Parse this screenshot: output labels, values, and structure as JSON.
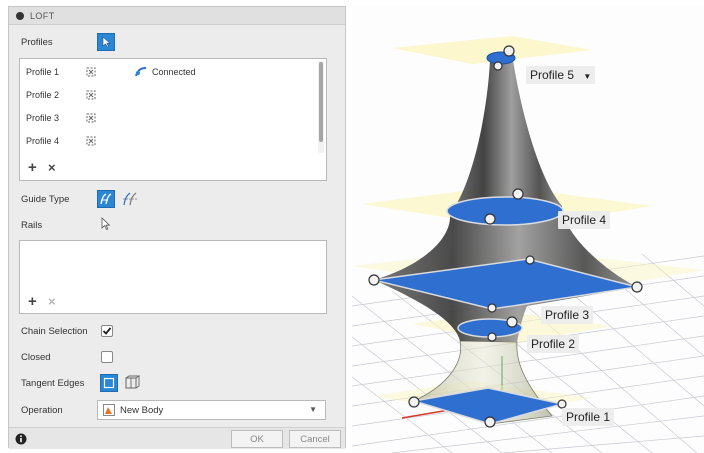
{
  "dialog": {
    "title": "LOFT",
    "profiles_label": "Profiles",
    "profile_list": [
      {
        "label": "Profile 1",
        "status": "Connected"
      },
      {
        "label": "Profile 2",
        "status": ""
      },
      {
        "label": "Profile 3",
        "status": ""
      },
      {
        "label": "Profile 4",
        "status": ""
      }
    ],
    "guide_type_label": "Guide Type",
    "rails_label": "Rails",
    "chain_selection_label": "Chain Selection",
    "chain_selection_checked": true,
    "closed_label": "Closed",
    "closed_checked": false,
    "tangent_edges_label": "Tangent Edges",
    "operation_label": "Operation",
    "operation_value": "New Body",
    "ok_label": "OK",
    "cancel_label": "Cancel"
  },
  "viewport": {
    "labels": {
      "profile5": "Profile 5",
      "profile4": "Profile 4",
      "profile3": "Profile 3",
      "profile2": "Profile 2",
      "profile1": "Profile 1"
    }
  },
  "colors": {
    "accent": "#2b86d6",
    "profile_fill": "#2f6fcf",
    "plane_fill": "#fbf5bf"
  }
}
